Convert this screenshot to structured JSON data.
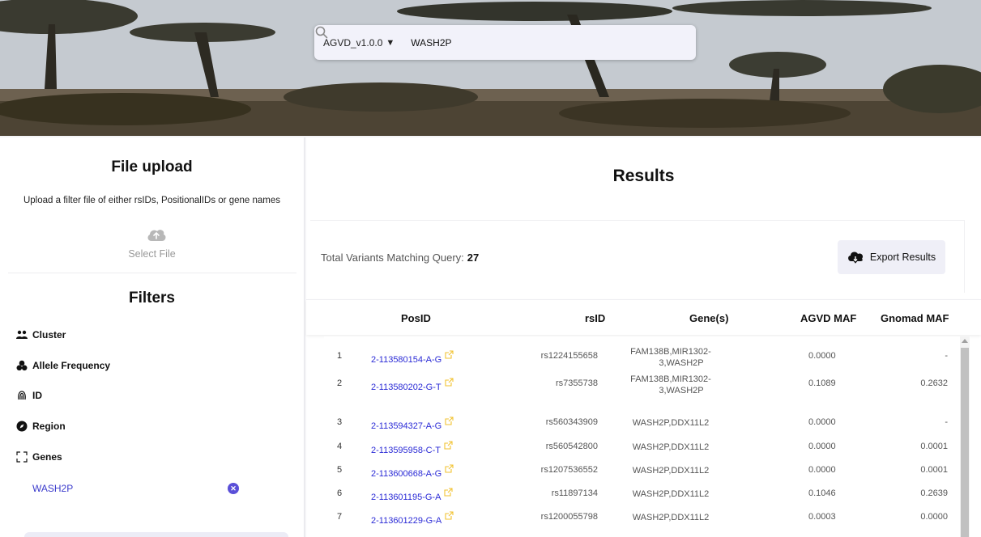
{
  "search": {
    "dataset": "AGVD_v1.0.0",
    "query": "WASH2P",
    "icon": "magnifier"
  },
  "file_upload": {
    "title": "File upload",
    "description": "Upload a filter file of either rsIDs, PositionalIDs or gene names",
    "select_label": "Select File",
    "icon": "cloud-upload"
  },
  "filters": {
    "title": "Filters",
    "items": [
      {
        "label": "Cluster",
        "icon": "people"
      },
      {
        "label": "Allele Frequency",
        "icon": "circles"
      },
      {
        "label": "ID",
        "icon": "fingerprint"
      },
      {
        "label": "Region",
        "icon": "compass"
      },
      {
        "label": "Genes",
        "icon": "expand"
      }
    ],
    "selected_gene": "WASH2P"
  },
  "results": {
    "title": "Results",
    "total_label": "Total Variants Matching Query:",
    "total_value": "27",
    "export_label": "Export Results",
    "columns": [
      "PosID",
      "rsID",
      "Gene(s)",
      "AGVD MAF",
      "Gnomad MAF"
    ],
    "rows": [
      {
        "idx": "1",
        "posid": "2-113580154-A-G",
        "rsid": "rs1224155658",
        "gene1": "FAM138B,MIR1302-",
        "gene2": "3,WASH2P",
        "agvd": "0.0000",
        "gnomad": "-"
      },
      {
        "idx": "2",
        "posid": "2-113580202-G-T",
        "rsid": "rs7355738",
        "gene1": "FAM138B,MIR1302-",
        "gene2": "3,WASH2P",
        "agvd": "0.1089",
        "gnomad": "0.2632"
      },
      {
        "idx": "3",
        "posid": "2-113594327-A-G",
        "rsid": "rs560343909",
        "gene1": "WASH2P,DDX11L2",
        "gene2": "",
        "agvd": "0.0000",
        "gnomad": "-"
      },
      {
        "idx": "4",
        "posid": "2-113595958-C-T",
        "rsid": "rs560542800",
        "gene1": "WASH2P,DDX11L2",
        "gene2": "",
        "agvd": "0.0000",
        "gnomad": "0.0001"
      },
      {
        "idx": "5",
        "posid": "2-113600668-A-G",
        "rsid": "rs1207536552",
        "gene1": "WASH2P,DDX11L2",
        "gene2": "",
        "agvd": "0.0000",
        "gnomad": "0.0001"
      },
      {
        "idx": "6",
        "posid": "2-113601195-G-A",
        "rsid": "rs11897134",
        "gene1": "WASH2P,DDX11L2",
        "gene2": "",
        "agvd": "0.1046",
        "gnomad": "0.2639"
      },
      {
        "idx": "7",
        "posid": "2-113601229-G-A",
        "rsid": "rs1200055798",
        "gene1": "WASH2P,DDX11L2",
        "gene2": "",
        "agvd": "0.0003",
        "gnomad": "0.0000"
      }
    ]
  },
  "colors": {
    "link": "#2a2ad6",
    "external_link_icon": "#f2c230",
    "chip_remove": "#5a4fd8"
  }
}
